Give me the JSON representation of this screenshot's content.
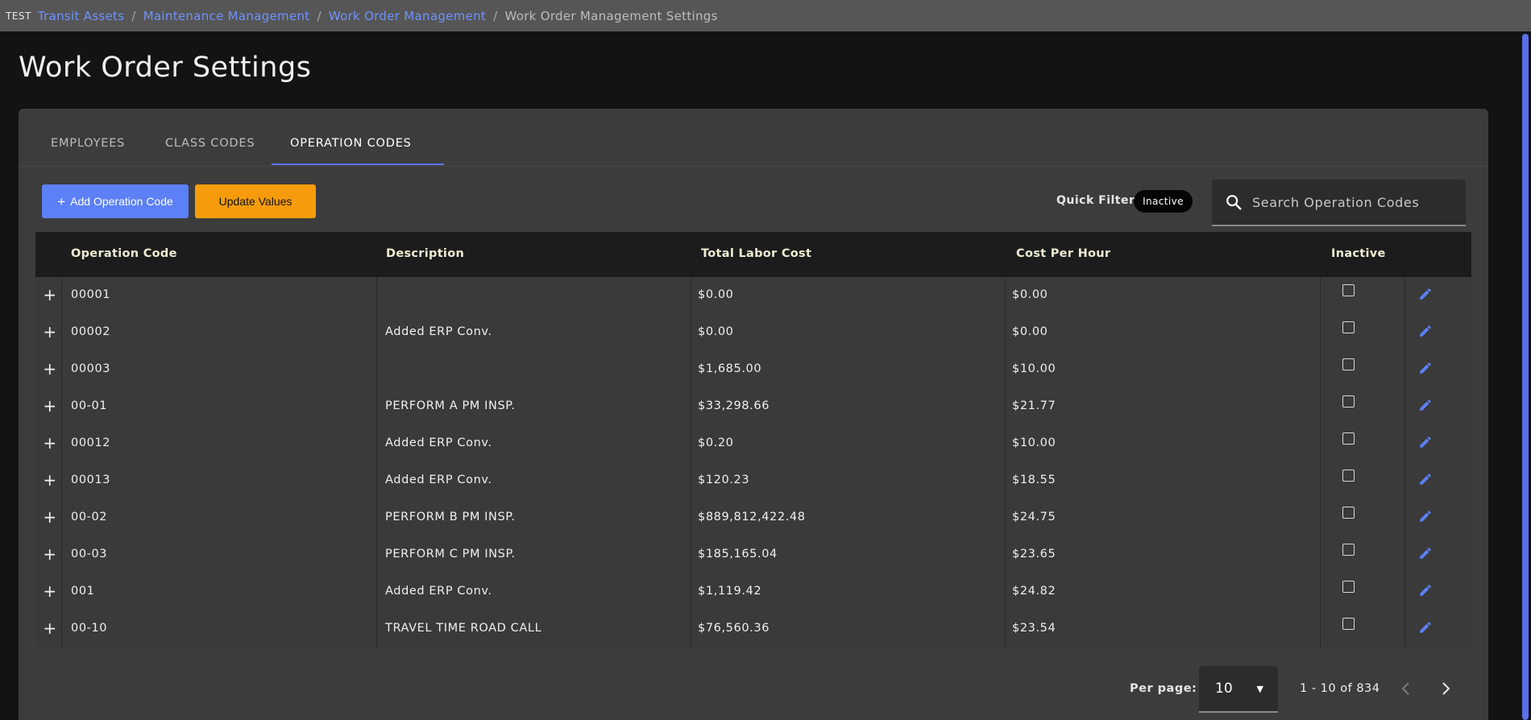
{
  "env_label": "TEST",
  "breadcrumb": {
    "items": [
      "Transit Assets",
      "Maintenance Management",
      "Work Order Management"
    ],
    "current": "Work Order Management Settings",
    "separator": "/"
  },
  "page_title": "Work Order Settings",
  "tabs": [
    {
      "label": "EMPLOYEES",
      "active": false
    },
    {
      "label": "CLASS CODES",
      "active": false
    },
    {
      "label": "OPERATION CODES",
      "active": true
    }
  ],
  "toolbar": {
    "add_label": "Add Operation Code",
    "update_label": "Update Values",
    "quick_filter_label": "Quick Filter:",
    "quick_filter_chip": "Inactive",
    "search_placeholder": "Search Operation Codes"
  },
  "table": {
    "columns": [
      "Operation Code",
      "Description",
      "Total Labor Cost",
      "Cost Per Hour",
      "Inactive"
    ],
    "rows": [
      {
        "code": "00001",
        "description": "",
        "total_labor_cost": "$0.00",
        "cost_per_hour": "$0.00",
        "inactive": false
      },
      {
        "code": "00002",
        "description": "Added ERP Conv.",
        "total_labor_cost": "$0.00",
        "cost_per_hour": "$0.00",
        "inactive": false
      },
      {
        "code": "00003",
        "description": "",
        "total_labor_cost": "$1,685.00",
        "cost_per_hour": "$10.00",
        "inactive": false
      },
      {
        "code": "00-01",
        "description": "PERFORM A PM INSP.",
        "total_labor_cost": "$33,298.66",
        "cost_per_hour": "$21.77",
        "inactive": false
      },
      {
        "code": "00012",
        "description": "Added ERP Conv.",
        "total_labor_cost": "$0.20",
        "cost_per_hour": "$10.00",
        "inactive": false
      },
      {
        "code": "00013",
        "description": "Added ERP Conv.",
        "total_labor_cost": "$120.23",
        "cost_per_hour": "$18.55",
        "inactive": false
      },
      {
        "code": "00-02",
        "description": "PERFORM B PM INSP.",
        "total_labor_cost": "$889,812,422.48",
        "cost_per_hour": "$24.75",
        "inactive": false
      },
      {
        "code": "00-03",
        "description": "PERFORM C PM INSP.",
        "total_labor_cost": "$185,165.04",
        "cost_per_hour": "$23.65",
        "inactive": false
      },
      {
        "code": "001",
        "description": "Added ERP Conv.",
        "total_labor_cost": "$1,119.42",
        "cost_per_hour": "$24.82",
        "inactive": false
      },
      {
        "code": "00-10",
        "description": "TRAVEL TIME ROAD CALL",
        "total_labor_cost": "$76,560.36",
        "cost_per_hour": "$23.54",
        "inactive": false
      }
    ]
  },
  "pagination": {
    "per_page_label": "Per page:",
    "per_page_value": "10",
    "range_text": "1 - 10 of 834"
  },
  "icons": {
    "add": "plus-icon",
    "search": "search-icon",
    "edit": "pencil-icon",
    "expand": "plus-icon",
    "dropdown": "caret-down-icon",
    "prev": "chevron-left-icon",
    "next": "chevron-right-icon"
  },
  "colors": {
    "accent": "#5d80f6",
    "warning": "#f69c0c",
    "link": "#6f93ff",
    "header_text": "#eeecd2"
  }
}
